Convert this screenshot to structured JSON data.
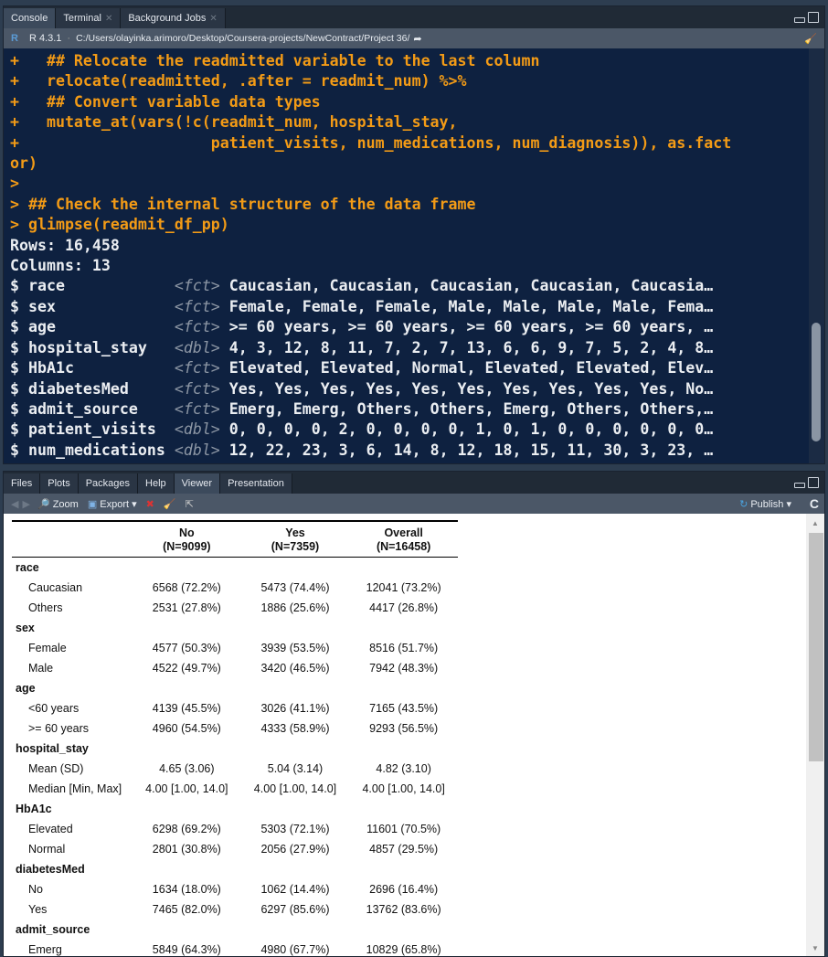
{
  "console": {
    "tabs": [
      "Console",
      "Terminal",
      "Background Jobs"
    ],
    "r_version": "R 4.3.1",
    "path": "C:/Users/olayinka.arimoro/Desktop/Coursera-projects/NewContract/Project 36/",
    "lines": [
      {
        "t": "+   ## Relocate the readmitted variable to the last column",
        "c": "cmd"
      },
      {
        "t": "+   relocate(readmitted, .after = readmit_num) %>%",
        "c": "cmd"
      },
      {
        "t": "+   ## Convert variable data types",
        "c": "cmd"
      },
      {
        "t": "+   mutate_at(vars(!c(readmit_num, hospital_stay,",
        "c": "cmd"
      },
      {
        "t": "+                     patient_visits, num_medications, num_diagnosis)), as.fact",
        "c": "cmd"
      },
      {
        "t": "or)",
        "c": "cmd"
      },
      {
        "t": ">",
        "c": "cmd"
      },
      {
        "t": "> ## Check the internal structure of the data frame",
        "c": "cmd"
      },
      {
        "t": "> glimpse(readmit_df_pp)",
        "c": "cmd"
      },
      {
        "t": "Rows: 16,458",
        "c": "out"
      },
      {
        "t": "Columns: 13",
        "c": "out"
      }
    ],
    "glimpse": [
      {
        "name": "$ race           ",
        "type": "<fct>",
        "vals": " Caucasian, Caucasian, Caucasian, Caucasian, Caucasia…"
      },
      {
        "name": "$ sex            ",
        "type": "<fct>",
        "vals": " Female, Female, Female, Male, Male, Male, Male, Fema…"
      },
      {
        "name": "$ age            ",
        "type": "<fct>",
        "vals": " >= 60 years, >= 60 years, >= 60 years, >= 60 years, …"
      },
      {
        "name": "$ hospital_stay  ",
        "type": "<dbl>",
        "vals": " 4, 3, 12, 8, 11, 7, 2, 7, 13, 6, 6, 9, 7, 5, 2, 4, 8…"
      },
      {
        "name": "$ HbA1c          ",
        "type": "<fct>",
        "vals": " Elevated, Elevated, Normal, Elevated, Elevated, Elev…"
      },
      {
        "name": "$ diabetesMed    ",
        "type": "<fct>",
        "vals": " Yes, Yes, Yes, Yes, Yes, Yes, Yes, Yes, Yes, Yes, No…"
      },
      {
        "name": "$ admit_source   ",
        "type": "<fct>",
        "vals": " Emerg, Emerg, Others, Others, Emerg, Others, Others,…"
      },
      {
        "name": "$ patient_visits ",
        "type": "<dbl>",
        "vals": " 0, 0, 0, 0, 2, 0, 0, 0, 0, 1, 0, 1, 0, 0, 0, 0, 0, 0…"
      },
      {
        "name": "$ num_medications",
        "type": "<dbl>",
        "vals": " 12, 22, 23, 3, 6, 14, 8, 12, 18, 15, 11, 30, 3, 23, …"
      }
    ]
  },
  "viewer": {
    "tabs": [
      "Files",
      "Plots",
      "Packages",
      "Help",
      "Viewer",
      "Presentation"
    ],
    "toolbar": {
      "zoom": "Zoom",
      "export": "Export",
      "publish": "Publish"
    },
    "table": {
      "headers": [
        [
          "",
          ""
        ],
        [
          "No",
          "(N=9099)"
        ],
        [
          "Yes",
          "(N=7359)"
        ],
        [
          "Overall",
          "(N=16458)"
        ]
      ],
      "groups": [
        {
          "name": "race",
          "rows": [
            [
              "Caucasian",
              "6568 (72.2%)",
              "5473 (74.4%)",
              "12041 (73.2%)"
            ],
            [
              "Others",
              "2531 (27.8%)",
              "1886 (25.6%)",
              "4417 (26.8%)"
            ]
          ]
        },
        {
          "name": "sex",
          "rows": [
            [
              "Female",
              "4577 (50.3%)",
              "3939 (53.5%)",
              "8516 (51.7%)"
            ],
            [
              "Male",
              "4522 (49.7%)",
              "3420 (46.5%)",
              "7942 (48.3%)"
            ]
          ]
        },
        {
          "name": "age",
          "rows": [
            [
              "<60 years",
              "4139 (45.5%)",
              "3026 (41.1%)",
              "7165 (43.5%)"
            ],
            [
              ">= 60 years",
              "4960 (54.5%)",
              "4333 (58.9%)",
              "9293 (56.5%)"
            ]
          ]
        },
        {
          "name": "hospital_stay",
          "rows": [
            [
              "Mean (SD)",
              "4.65 (3.06)",
              "5.04 (3.14)",
              "4.82 (3.10)"
            ],
            [
              "Median [Min, Max]",
              "4.00 [1.00, 14.0]",
              "4.00 [1.00, 14.0]",
              "4.00 [1.00, 14.0]"
            ]
          ]
        },
        {
          "name": "HbA1c",
          "rows": [
            [
              "Elevated",
              "6298 (69.2%)",
              "5303 (72.1%)",
              "11601 (70.5%)"
            ],
            [
              "Normal",
              "2801 (30.8%)",
              "2056 (27.9%)",
              "4857 (29.5%)"
            ]
          ]
        },
        {
          "name": "diabetesMed",
          "rows": [
            [
              "No",
              "1634 (18.0%)",
              "1062 (14.4%)",
              "2696 (16.4%)"
            ],
            [
              "Yes",
              "7465 (82.0%)",
              "6297 (85.6%)",
              "13762 (83.6%)"
            ]
          ]
        },
        {
          "name": "admit_source",
          "rows": [
            [
              "Emerg",
              "5849 (64.3%)",
              "4980 (67.7%)",
              "10829 (65.8%)"
            ]
          ]
        }
      ]
    }
  }
}
